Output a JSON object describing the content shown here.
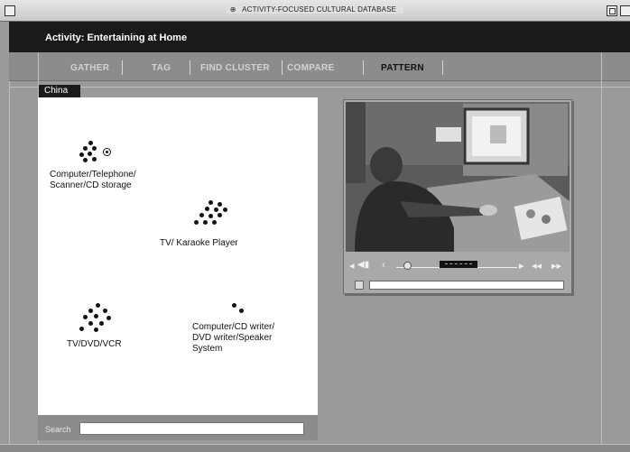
{
  "window": {
    "title": "ACTIVITY-FOCUSED CULTURAL DATABASE"
  },
  "header": {
    "activity": "Activity: Entertaining at Home"
  },
  "nav": [
    "GATHER",
    "TAG",
    "FIND CLUSTER",
    "COMPARE",
    "PATTERN"
  ],
  "nav_active": "PATTERN",
  "region_tab": "China",
  "clusters": [
    {
      "label": "Computer/Telephone/\nScanner/CD storage"
    },
    {
      "label": "TV/ Karaoke Player"
    },
    {
      "label": "TV/DVD/VCR"
    },
    {
      "label": "Computer/CD writer/\nDVD writer/Speaker\nSystem"
    }
  ],
  "search": {
    "label": "Search",
    "value": ""
  },
  "player": {
    "controls": [
      "step-back-icon",
      "volume-icon",
      "rewind-icon",
      "play-icon",
      "skip-back-icon",
      "skip-forward-icon"
    ]
  },
  "colors": {
    "header": "#1a1a1a",
    "nav": "#8c8c8c",
    "panel": "#ffffff",
    "background": "#9a9a9a"
  }
}
